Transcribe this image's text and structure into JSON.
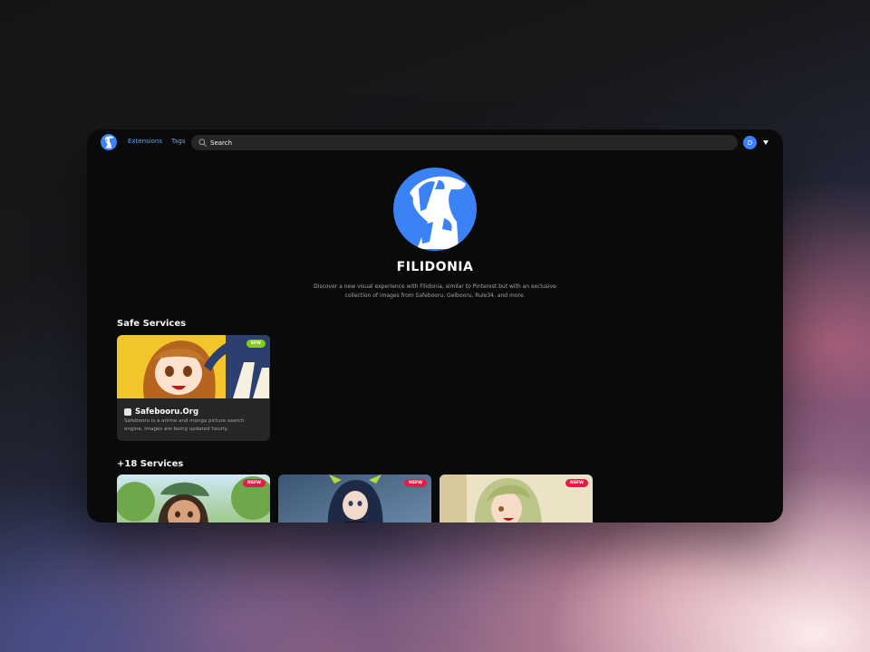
{
  "navbar": {
    "links": [
      "Extensions",
      "Tags"
    ],
    "search_placeholder": "Search",
    "avatar_initial": "D"
  },
  "hero": {
    "title": "FILIDONIA",
    "tagline": "Discover a new visual experience with Filidonia, similar to Pinterest but with an exclusive collection of images from Safebooru, Gelbooru, Rule34, and more."
  },
  "safe_section": {
    "title": "Safe Services",
    "cards": [
      {
        "title": "Safebooru.Org",
        "badge": "SFW",
        "description": "Safebooru is a anime and manga picture search engine, images are being updated hourly."
      }
    ]
  },
  "nsfw_section": {
    "title": "+18 Services",
    "cards": [
      {
        "badge": "NSFW"
      },
      {
        "badge": "NSFW"
      },
      {
        "badge": "NSFW"
      }
    ]
  },
  "colors": {
    "accent": "#3b82f6",
    "link": "#60a5fa",
    "sfw": "#84cc16",
    "nsfw": "#e11d48"
  },
  "icons": [
    "app-logo-icon",
    "search-icon",
    "chevron-down-icon",
    "favicon-icon"
  ]
}
